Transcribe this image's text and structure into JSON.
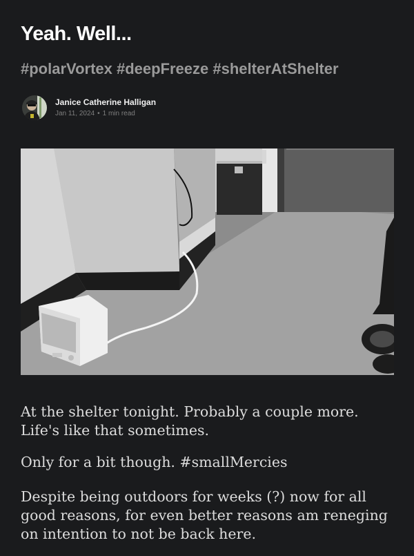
{
  "post": {
    "title": "Yeah. Well...",
    "subtitle": "#polarVortex #deepFreeze #shelterAtShelter",
    "author": "Janice Catherine Halligan",
    "date": "Jan 11, 2024",
    "separator": "•",
    "read_time": "1 min read",
    "paragraphs": [
      "At the shelter tonight. Probably a couple more. Life's like that sometimes.",
      "Only for a bit though. #smallMercies",
      "Despite being outdoors for weeks (?) now for all good reasons, for even better reasons am reneging on intention to not be back here."
    ]
  },
  "colors": {
    "background": "#1a1b1d",
    "title": "#ffffff",
    "subtitle": "#9a9a9a",
    "body": "#dcdcdc",
    "meta": "#7e7e7e"
  },
  "icons": {
    "avatar": "author-avatar-photo"
  }
}
